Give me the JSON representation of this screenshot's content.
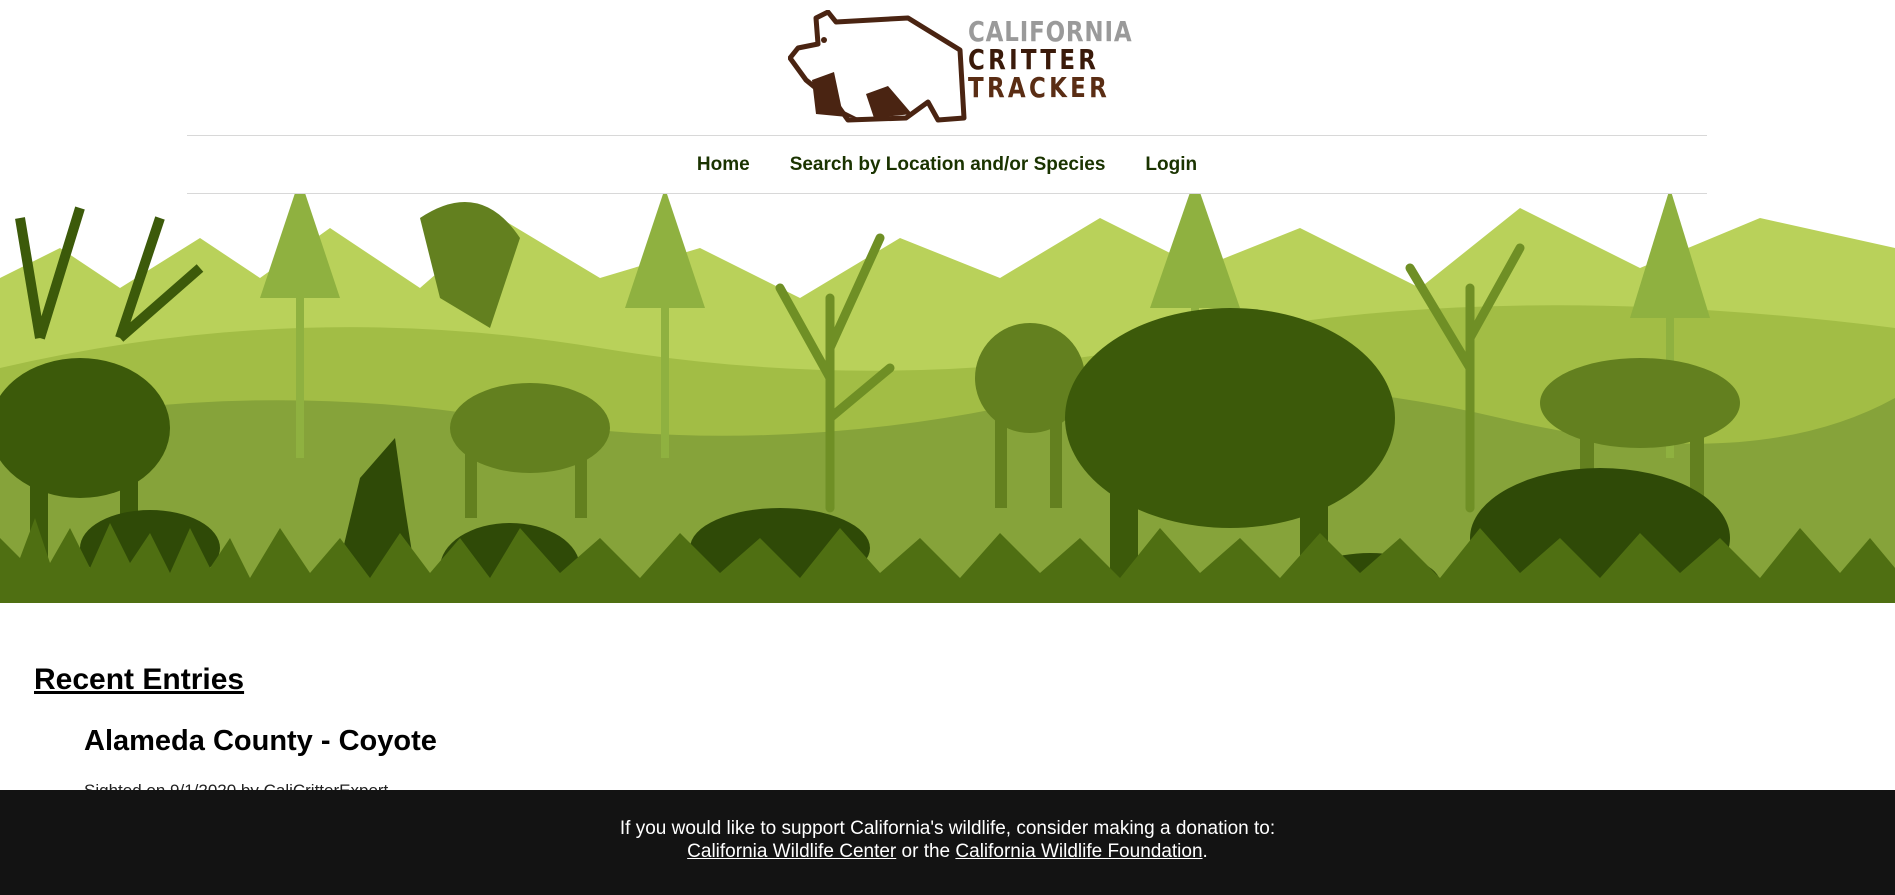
{
  "header": {
    "logo": {
      "line1": "CALIFORNIA",
      "line2": "CRITTER",
      "line3": "TRACKER"
    }
  },
  "nav": {
    "items": [
      {
        "label": "Home"
      },
      {
        "label": "Search by Location and/or Species"
      },
      {
        "label": "Login"
      }
    ]
  },
  "hero": {
    "icon": "wildlife-forest-banner"
  },
  "main": {
    "section_title": "Recent Entries",
    "entries": [
      {
        "title": "Alameda County - Coyote",
        "meta": "Sighted on 9/1/2020 by CaliCritterExpert"
      }
    ]
  },
  "footer": {
    "text": "If you would like to support California's wildlife, consider making a donation to:",
    "link1": "California Wildlife Center",
    "middle": "or the",
    "link2": "California Wildlife Foundation",
    "end": "."
  },
  "colors": {
    "nav_text": "#1a3300",
    "footer_bg": "#131313",
    "logo_brown": "#4a2412",
    "logo_gray": "#9a9a9a",
    "forest_dark": "#2f4a07",
    "forest_mid": "#5c7a1a",
    "forest_light": "#a8c24a"
  }
}
